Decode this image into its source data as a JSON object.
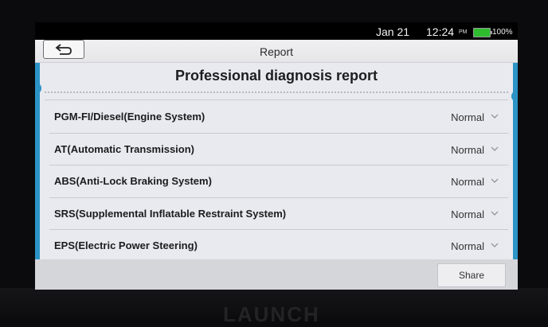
{
  "status_bar": {
    "date": "Jan 21",
    "time": "12:24",
    "ampm": "PM",
    "battery": "100%"
  },
  "title_bar": {
    "back_icon": "back-arrow-icon",
    "title": "Report"
  },
  "report": {
    "heading": "Professional diagnosis report",
    "systems": [
      {
        "name": "PGM-FI/Diesel(Engine System)",
        "status": "Normal"
      },
      {
        "name": "AT(Automatic Transmission)",
        "status": "Normal"
      },
      {
        "name": "ABS(Anti-Lock Braking System)",
        "status": "Normal"
      },
      {
        "name": "SRS(Supplemental Inflatable Restraint System)",
        "status": "Normal"
      },
      {
        "name": "EPS(Electric Power Steering)",
        "status": "Normal"
      }
    ]
  },
  "footer": {
    "share_label": "Share"
  },
  "device": {
    "brand_logo": "LAUNCH"
  },
  "colors": {
    "accent": "#2b93c6",
    "battery": "#2fbd2f"
  }
}
